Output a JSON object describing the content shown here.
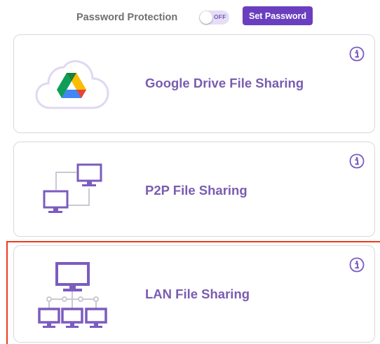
{
  "header": {
    "password_label": "Password Protection",
    "toggle_state_label": "OFF",
    "set_password_label": "Set Password"
  },
  "cards": [
    {
      "title": "Google Drive File Sharing",
      "icon": "google-drive-cloud-icon",
      "info_icon": "info-icon"
    },
    {
      "title": "P2P File Sharing",
      "icon": "p2p-network-icon",
      "info_icon": "info-icon"
    },
    {
      "title": "LAN File Sharing",
      "icon": "lan-network-icon",
      "info_icon": "info-icon",
      "selected": true
    }
  ],
  "colors": {
    "accent": "#6a3fbf",
    "title": "#7a5cb0",
    "icon": "#7b5cbf",
    "highlight": "#ee3a1c",
    "card_border": "#d9d9de"
  }
}
